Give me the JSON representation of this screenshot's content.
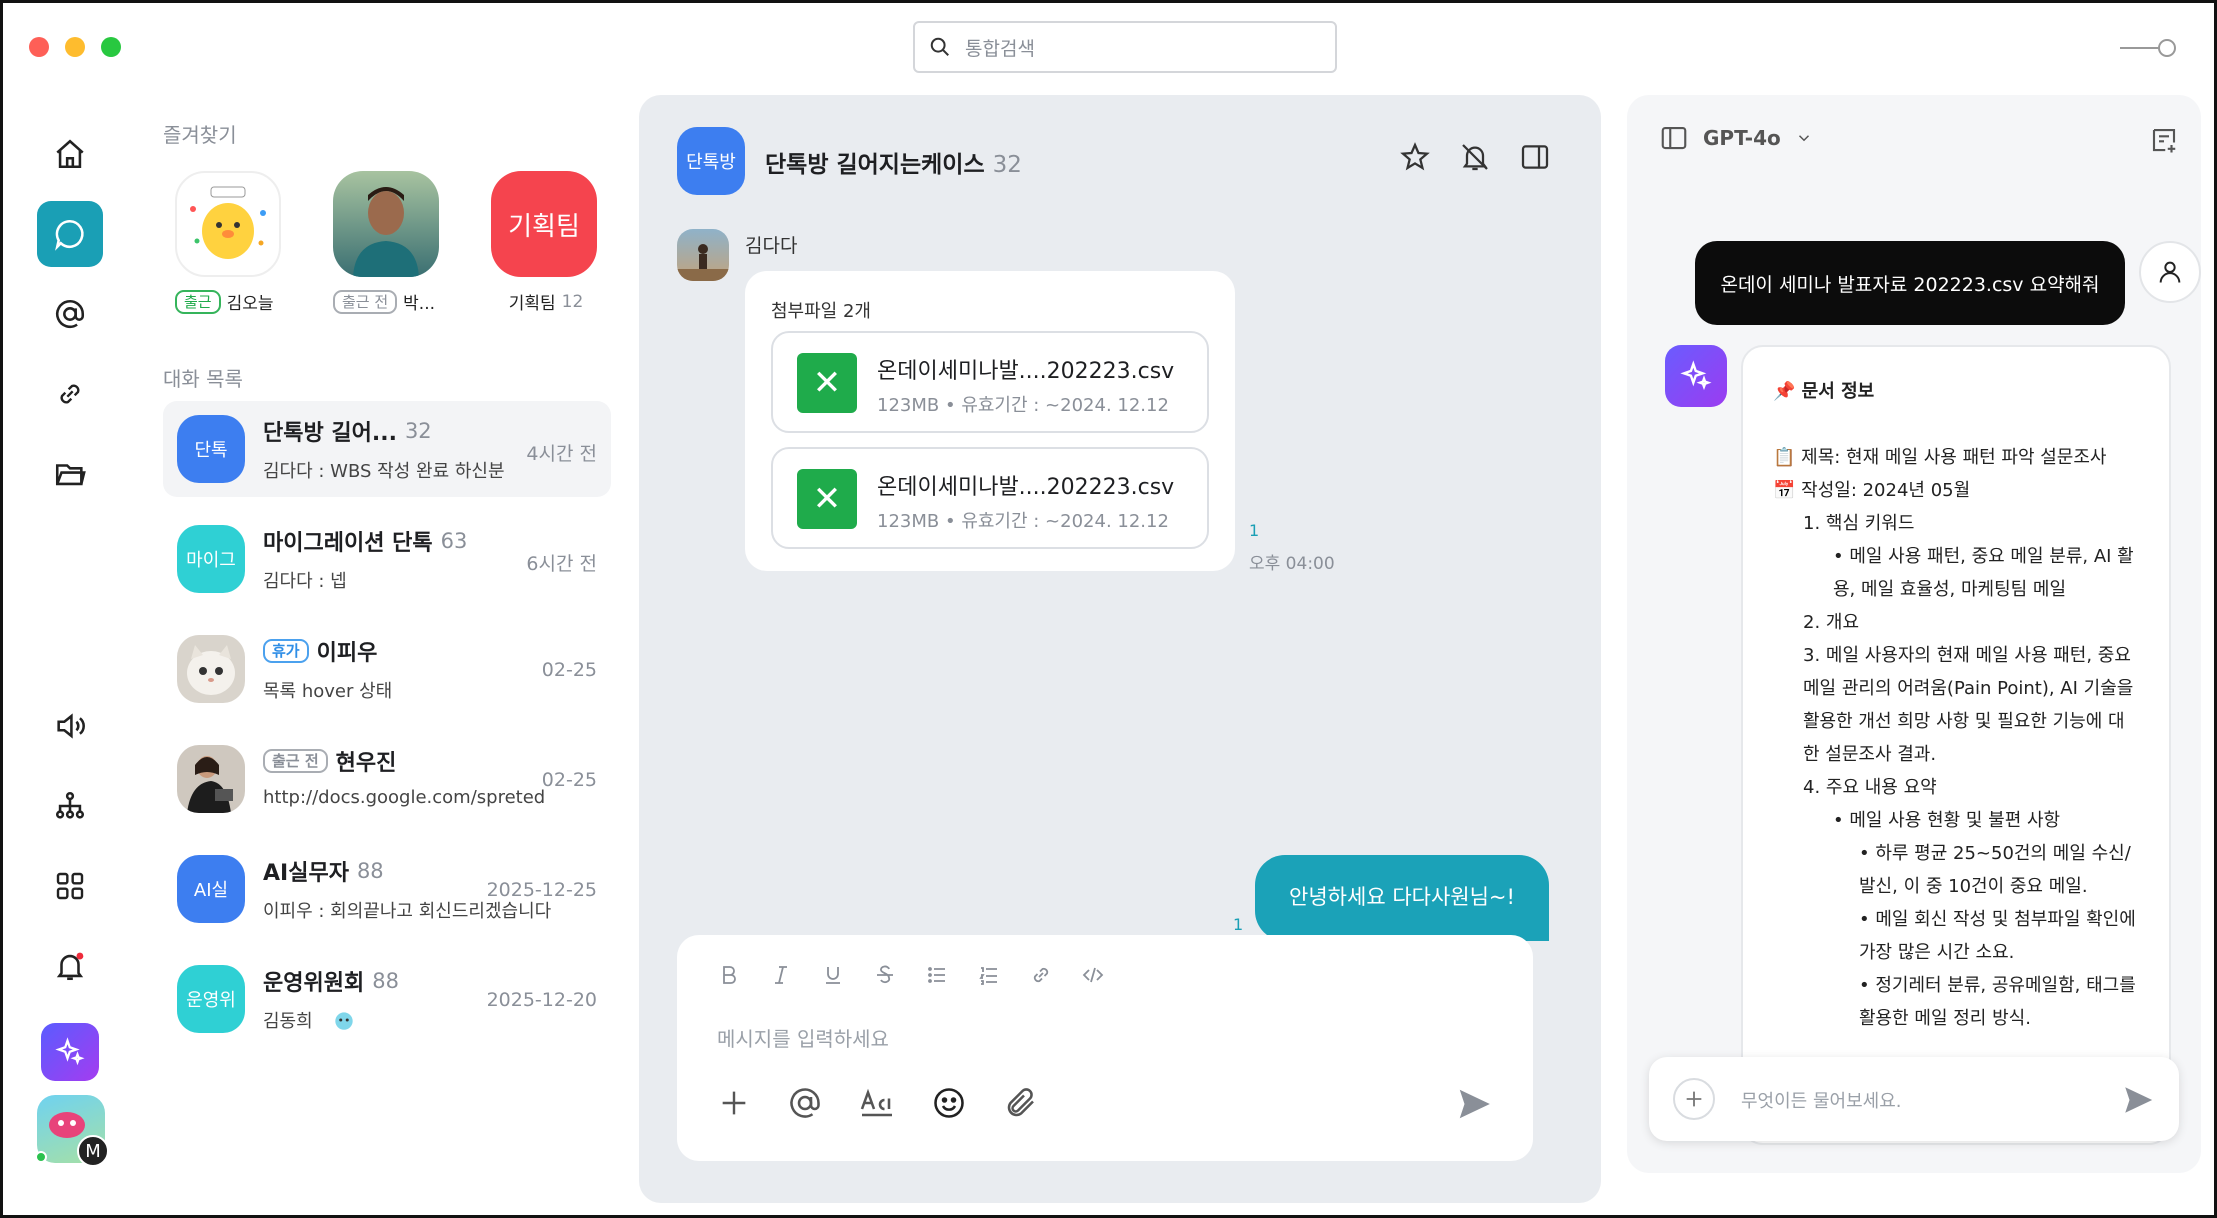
{
  "search": {
    "placeholder": "통합검색"
  },
  "colors": {
    "accent": "#1a9fb5",
    "brand_blue": "#3d7ef0",
    "excel_green": "#1fab4b",
    "team_red": "#f5444e"
  },
  "favorites": {
    "title": "즐겨찾기",
    "items": [
      {
        "status": "출근",
        "name": "김오늘"
      },
      {
        "status": "출근 전",
        "name": "박..."
      },
      {
        "avatar_text": "기획팀",
        "name": "기획팀",
        "count": "12"
      }
    ]
  },
  "conversations": {
    "title": "대화 목록",
    "items": [
      {
        "avatar_text": "단톡",
        "name": "단톡방 길어...",
        "count": "32",
        "preview": "김다다 : WBS 작성 완료 하신분",
        "time": "4시간 전"
      },
      {
        "avatar_text": "마이그",
        "name": "마이그레이션 단톡",
        "count": "63",
        "preview": "김다다 : 넵",
        "time": "6시간 전"
      },
      {
        "status": "휴가",
        "name": "이피우",
        "preview": "목록 hover 상태",
        "time": "02-25"
      },
      {
        "status": "출근 전",
        "name": "현우진",
        "preview": "http://docs.google.com/spreted",
        "time": "02-25"
      },
      {
        "avatar_text": "AI실",
        "name": "AI실무자",
        "count": "88",
        "preview": "이피우 : 회의끝나고 회신드리겠습니다",
        "time": "2025-12-25"
      },
      {
        "avatar_text": "운영위",
        "name": "운영위원회",
        "count": "88",
        "preview": "김동희",
        "time": "2025-12-20"
      }
    ]
  },
  "chat": {
    "avatar_text": "단톡방",
    "title": "단톡방 길어지는케이스",
    "count": "32",
    "sender": "김다다",
    "attachment_label": "첨부파일 2개",
    "files": [
      {
        "name": "온데이세미나발....202223.csv",
        "size": "123MB",
        "expiry": "유효기간 : ~2024. 12.12"
      },
      {
        "name": "온데이세미나발....202223.csv",
        "size": "123MB",
        "expiry": "유효기간 : ~2024. 12.12"
      }
    ],
    "read_count_1": "1",
    "time_1": "오후 04:00",
    "my_message": "안녕하세요 다다사원님~!",
    "read_count_2": "1",
    "composer_placeholder": "메시지를 입력하세요"
  },
  "ai": {
    "model": "GPT-4o",
    "question": "온데이 세미나 발표자료 202223.csv 요약해줘",
    "answer": {
      "heading": "📌 문서 정보",
      "title_line": "📋 제목: 현재 메일 사용 패턴 파악 설문조사",
      "date_line": "📅 작성일: 2024년 05월",
      "item1": "1. 핵심 키워드",
      "item1_sub": "• 메일 사용 패턴, 중요 메일 분류, AI 활용, 메일 효율성, 마케팅팀 메일",
      "item2": "2. 개요",
      "item3": "3. 메일 사용자의 현재 메일 사용 패턴, 중요 메일 관리의 어려움(Pain Point), AI 기술을 활용한 개선 희망 사항 및 필요한 기능에 대한 설문조사 결과.",
      "item4": "4. 주요 내용 요약",
      "item4_sub": "• 메일 사용 현황 및 불편 사항",
      "item4_sub_a": "• 하루 평균 25~50건의 메일 수신/발신, 이 중 10건이 중요 메일.",
      "item4_sub_b": "• 메일 회신 작성 및 첨부파일 확인에 가장 많은 시간 소요.",
      "item4_sub_c": "• 정기레터 분류, 공유메일함, 태그를 활용한 메일 정리 방식."
    },
    "input_placeholder": "무엇이든 물어보세요."
  },
  "user": {
    "avatar_letter": "M"
  }
}
